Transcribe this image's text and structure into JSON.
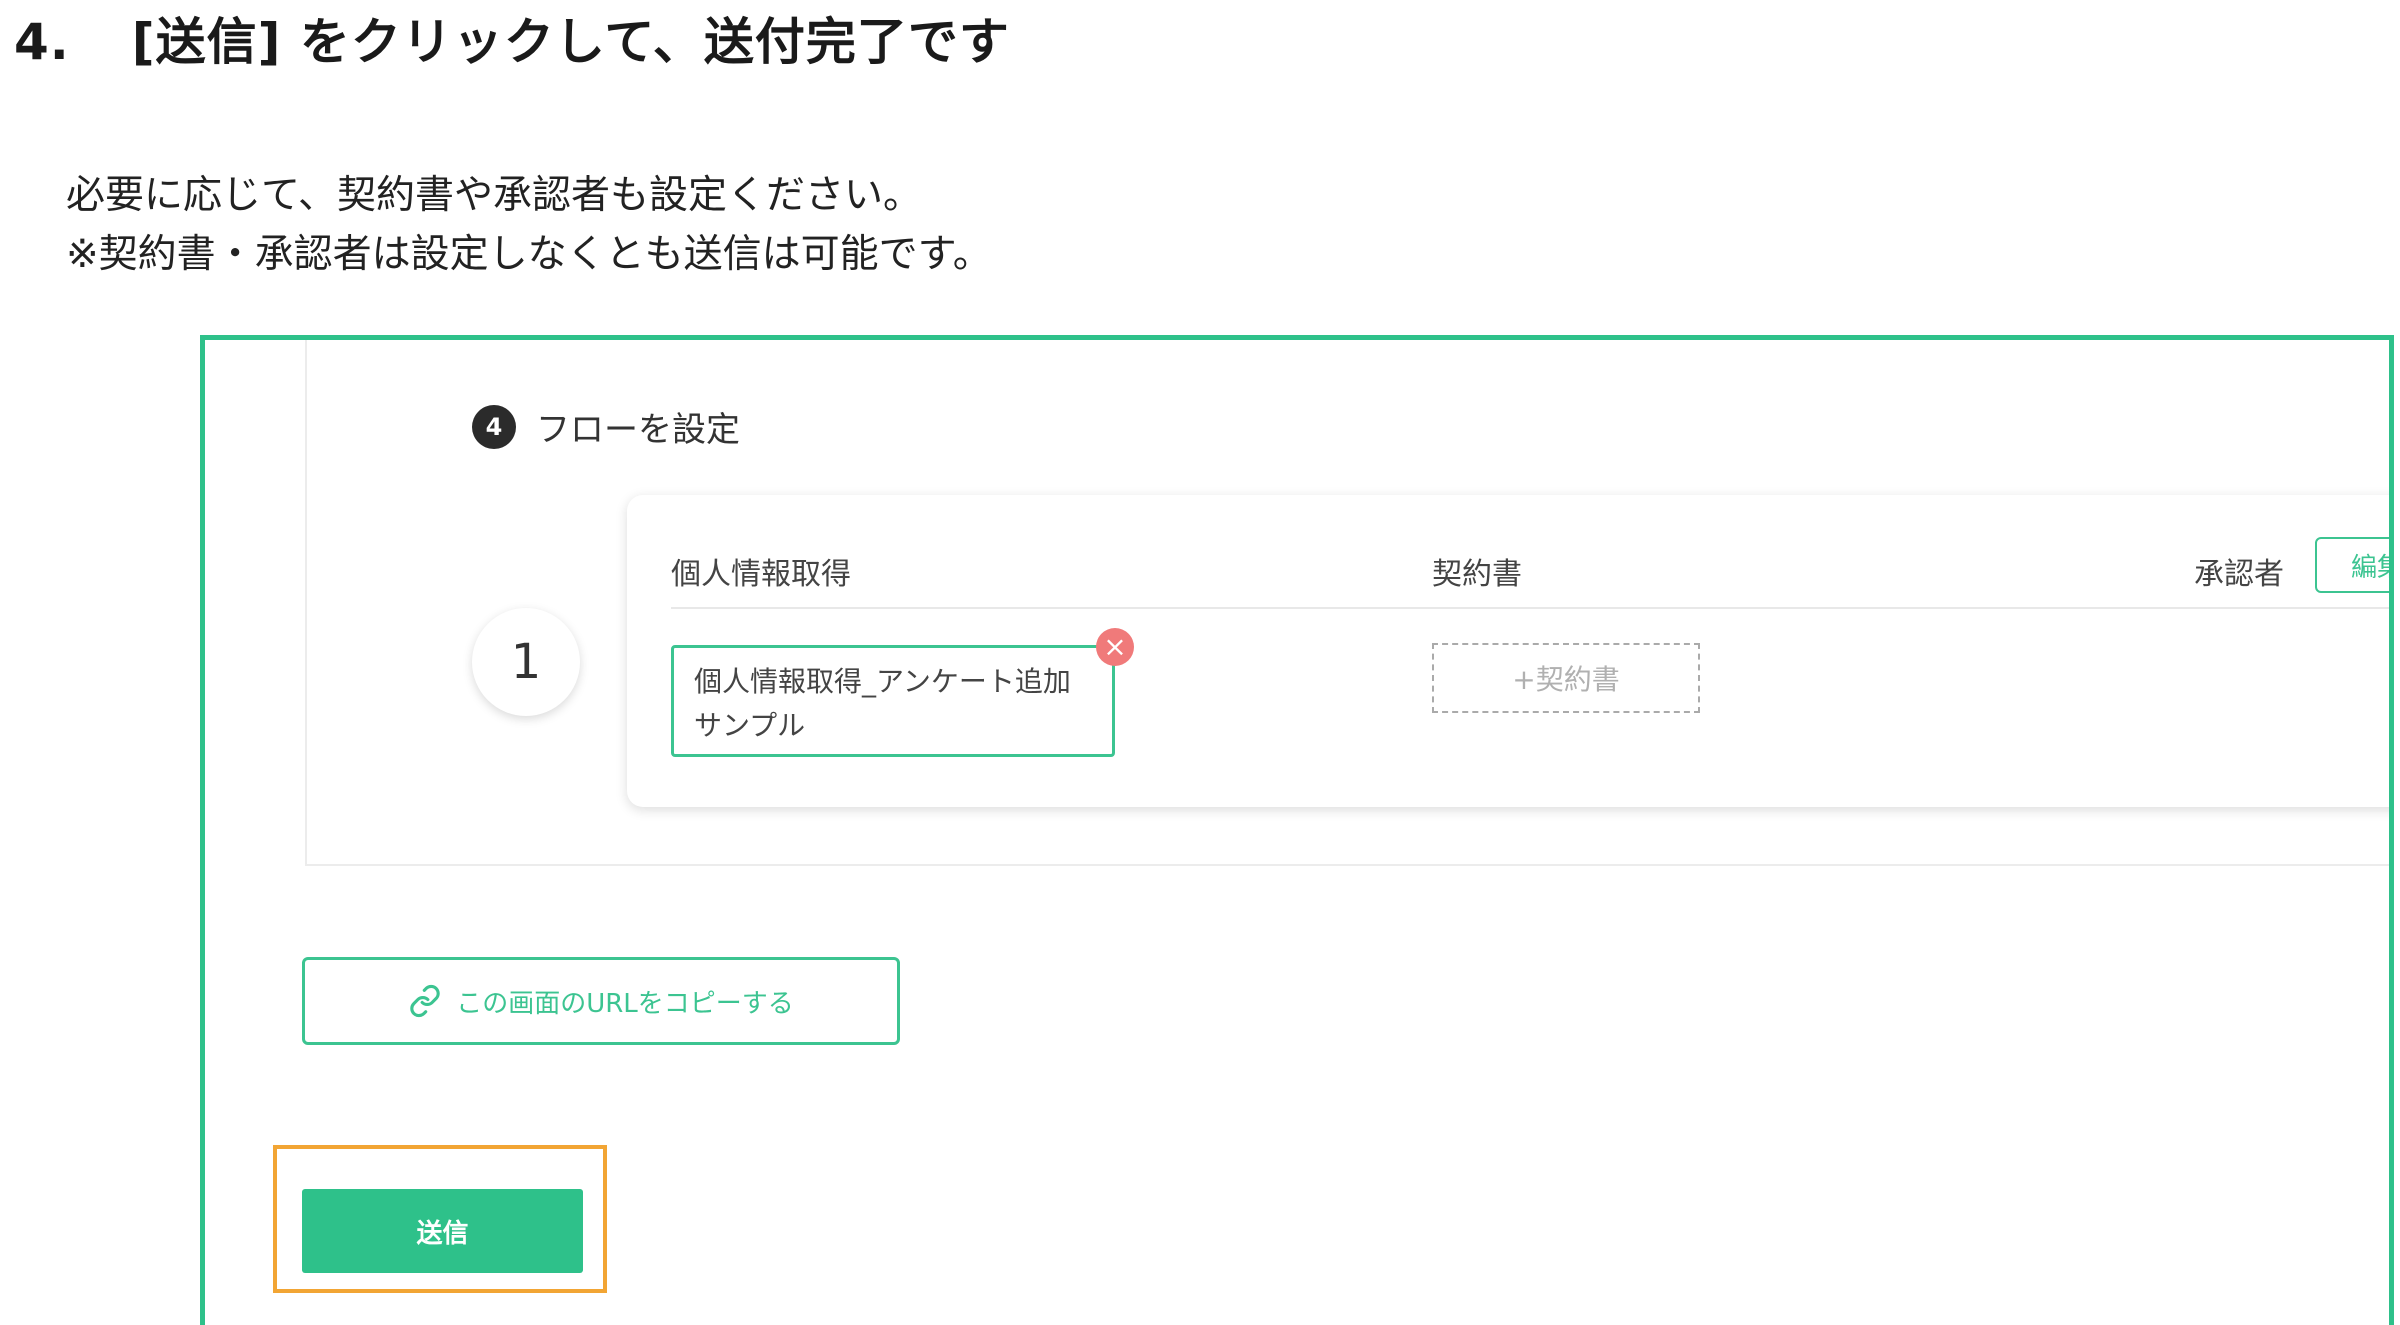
{
  "heading": {
    "number": "4.",
    "text": "[送信] をクリックして、送付完了です"
  },
  "description": {
    "line1": "必要に応じて、契約書や承認者も設定ください。",
    "line2": "※契約書・承認者は設定しなくとも送信は可能です。"
  },
  "screenshot": {
    "section": {
      "step_number": "4",
      "title": "フローを設定"
    },
    "flow": {
      "number": "1",
      "columns": {
        "personal_info": "個人情報取得",
        "contract": "契約書",
        "approver": "承認者"
      },
      "edit_label": "編集",
      "doc_chip": {
        "line1": "個人情報取得_アンケート追加",
        "line2": "サンプル"
      },
      "remove_icon": "×",
      "add_contract_label": "+契約書"
    },
    "copy_url": {
      "icon": "link-icon",
      "label": "この画面のURLをコピーする"
    },
    "send_label": "送信"
  },
  "colors": {
    "accent": "#2ec18a",
    "highlight": "#f2a534",
    "remove": "#f07a7a"
  }
}
